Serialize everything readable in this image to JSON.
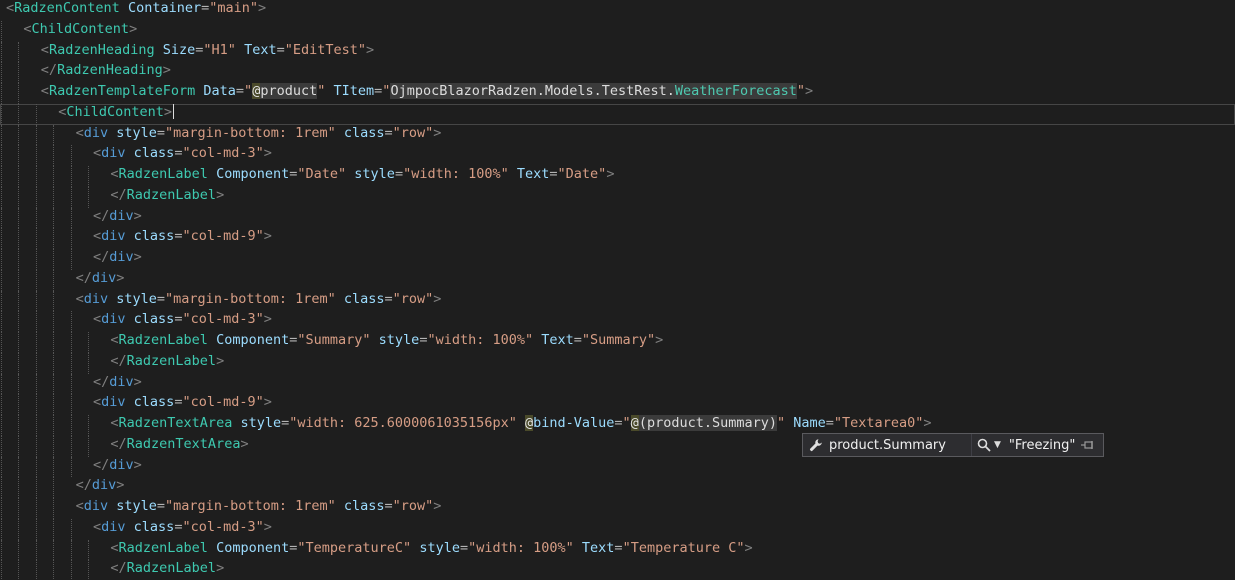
{
  "editor": {
    "lines": [
      {
        "indent": 0,
        "guides": 0,
        "tokens": [
          [
            "tk-bracket",
            "<"
          ],
          [
            "tk-comp",
            "RadzenContent"
          ],
          [
            "tk-csharp",
            " "
          ],
          [
            "tk-attr",
            "Container"
          ],
          [
            "tk-equals",
            "="
          ],
          [
            "tk-str",
            "\"main\""
          ],
          [
            "tk-bracket",
            ">"
          ]
        ]
      },
      {
        "indent": 1,
        "guides": 1,
        "tokens": [
          [
            "tk-bracket",
            "<"
          ],
          [
            "tk-comp",
            "ChildContent"
          ],
          [
            "tk-bracket",
            ">"
          ]
        ]
      },
      {
        "indent": 2,
        "guides": 2,
        "tokens": [
          [
            "tk-bracket",
            "<"
          ],
          [
            "tk-comp",
            "RadzenHeading"
          ],
          [
            "tk-csharp",
            " "
          ],
          [
            "tk-attr",
            "Size"
          ],
          [
            "tk-equals",
            "="
          ],
          [
            "tk-str",
            "\"H1\""
          ],
          [
            "tk-csharp",
            " "
          ],
          [
            "tk-attr",
            "Text"
          ],
          [
            "tk-equals",
            "="
          ],
          [
            "tk-str",
            "\"EditTest\""
          ],
          [
            "tk-bracket",
            ">"
          ]
        ]
      },
      {
        "indent": 2,
        "guides": 2,
        "tokens": [
          [
            "tk-bracket",
            "</"
          ],
          [
            "tk-comp",
            "RadzenHeading"
          ],
          [
            "tk-bracket",
            ">"
          ]
        ]
      },
      {
        "indent": 2,
        "guides": 2,
        "tokens": [
          [
            "tk-bracket",
            "<"
          ],
          [
            "tk-comp",
            "RadzenTemplateForm"
          ],
          [
            "tk-csharp",
            " "
          ],
          [
            "tk-attr",
            "Data"
          ],
          [
            "tk-equals",
            "="
          ],
          [
            "tk-str",
            "\""
          ],
          [
            "tk-at",
            "@"
          ],
          [
            "tk-hl",
            "product"
          ],
          [
            "tk-str",
            "\""
          ],
          [
            "tk-csharp",
            " "
          ],
          [
            "tk-attr",
            "TItem"
          ],
          [
            "tk-equals",
            "="
          ],
          [
            "tk-str",
            "\""
          ],
          [
            "tk-hl",
            "OjmpocBlazorRadzen.Models.TestRest."
          ],
          [
            "tk-type",
            "WeatherForecast"
          ],
          [
            "tk-str",
            "\""
          ],
          [
            "tk-bracket",
            ">"
          ]
        ]
      },
      {
        "indent": 3,
        "guides": 3,
        "current": true,
        "tokens": [
          [
            "tk-bracket",
            "<"
          ],
          [
            "tk-comp",
            "ChildContent"
          ],
          [
            "tk-bracket",
            ">"
          ]
        ]
      },
      {
        "indent": 4,
        "guides": 4,
        "tokens": [
          [
            "tk-bracket",
            "<"
          ],
          [
            "tk-tag",
            "div"
          ],
          [
            "tk-csharp",
            " "
          ],
          [
            "tk-attr",
            "style"
          ],
          [
            "tk-equals",
            "="
          ],
          [
            "tk-str",
            "\"margin-bottom: 1rem\""
          ],
          [
            "tk-csharp",
            " "
          ],
          [
            "tk-attr",
            "class"
          ],
          [
            "tk-equals",
            "="
          ],
          [
            "tk-str",
            "\"row\""
          ],
          [
            "tk-bracket",
            ">"
          ]
        ]
      },
      {
        "indent": 5,
        "guides": 5,
        "tokens": [
          [
            "tk-bracket",
            "<"
          ],
          [
            "tk-tag",
            "div"
          ],
          [
            "tk-csharp",
            " "
          ],
          [
            "tk-attr",
            "class"
          ],
          [
            "tk-equals",
            "="
          ],
          [
            "tk-str",
            "\"col-md-3\""
          ],
          [
            "tk-bracket",
            ">"
          ]
        ]
      },
      {
        "indent": 6,
        "guides": 6,
        "tokens": [
          [
            "tk-bracket",
            "<"
          ],
          [
            "tk-comp",
            "RadzenLabel"
          ],
          [
            "tk-csharp",
            " "
          ],
          [
            "tk-attr",
            "Component"
          ],
          [
            "tk-equals",
            "="
          ],
          [
            "tk-str",
            "\"Date\""
          ],
          [
            "tk-csharp",
            " "
          ],
          [
            "tk-attr",
            "style"
          ],
          [
            "tk-equals",
            "="
          ],
          [
            "tk-str",
            "\"width: 100%\""
          ],
          [
            "tk-csharp",
            " "
          ],
          [
            "tk-attr",
            "Text"
          ],
          [
            "tk-equals",
            "="
          ],
          [
            "tk-str",
            "\"Date\""
          ],
          [
            "tk-bracket",
            ">"
          ]
        ]
      },
      {
        "indent": 6,
        "guides": 6,
        "tokens": [
          [
            "tk-bracket",
            "</"
          ],
          [
            "tk-comp",
            "RadzenLabel"
          ],
          [
            "tk-bracket",
            ">"
          ]
        ]
      },
      {
        "indent": 5,
        "guides": 5,
        "tokens": [
          [
            "tk-bracket",
            "</"
          ],
          [
            "tk-tag",
            "div"
          ],
          [
            "tk-bracket",
            ">"
          ]
        ]
      },
      {
        "indent": 5,
        "guides": 5,
        "tokens": [
          [
            "tk-bracket",
            "<"
          ],
          [
            "tk-tag",
            "div"
          ],
          [
            "tk-csharp",
            " "
          ],
          [
            "tk-attr",
            "class"
          ],
          [
            "tk-equals",
            "="
          ],
          [
            "tk-str",
            "\"col-md-9\""
          ],
          [
            "tk-bracket",
            ">"
          ]
        ]
      },
      {
        "indent": 5,
        "guides": 5,
        "tokens": [
          [
            "tk-bracket",
            "</"
          ],
          [
            "tk-tag",
            "div"
          ],
          [
            "tk-bracket",
            ">"
          ]
        ]
      },
      {
        "indent": 4,
        "guides": 4,
        "tokens": [
          [
            "tk-bracket",
            "</"
          ],
          [
            "tk-tag",
            "div"
          ],
          [
            "tk-bracket",
            ">"
          ]
        ]
      },
      {
        "indent": 4,
        "guides": 4,
        "tokens": [
          [
            "tk-bracket",
            "<"
          ],
          [
            "tk-tag",
            "div"
          ],
          [
            "tk-csharp",
            " "
          ],
          [
            "tk-attr",
            "style"
          ],
          [
            "tk-equals",
            "="
          ],
          [
            "tk-str",
            "\"margin-bottom: 1rem\""
          ],
          [
            "tk-csharp",
            " "
          ],
          [
            "tk-attr",
            "class"
          ],
          [
            "tk-equals",
            "="
          ],
          [
            "tk-str",
            "\"row\""
          ],
          [
            "tk-bracket",
            ">"
          ]
        ]
      },
      {
        "indent": 5,
        "guides": 5,
        "tokens": [
          [
            "tk-bracket",
            "<"
          ],
          [
            "tk-tag",
            "div"
          ],
          [
            "tk-csharp",
            " "
          ],
          [
            "tk-attr",
            "class"
          ],
          [
            "tk-equals",
            "="
          ],
          [
            "tk-str",
            "\"col-md-3\""
          ],
          [
            "tk-bracket",
            ">"
          ]
        ]
      },
      {
        "indent": 6,
        "guides": 6,
        "tokens": [
          [
            "tk-bracket",
            "<"
          ],
          [
            "tk-comp",
            "RadzenLabel"
          ],
          [
            "tk-csharp",
            " "
          ],
          [
            "tk-attr",
            "Component"
          ],
          [
            "tk-equals",
            "="
          ],
          [
            "tk-str",
            "\"Summary\""
          ],
          [
            "tk-csharp",
            " "
          ],
          [
            "tk-attr",
            "style"
          ],
          [
            "tk-equals",
            "="
          ],
          [
            "tk-str",
            "\"width: 100%\""
          ],
          [
            "tk-csharp",
            " "
          ],
          [
            "tk-attr",
            "Text"
          ],
          [
            "tk-equals",
            "="
          ],
          [
            "tk-str",
            "\"Summary\""
          ],
          [
            "tk-bracket",
            ">"
          ]
        ]
      },
      {
        "indent": 6,
        "guides": 6,
        "tokens": [
          [
            "tk-bracket",
            "</"
          ],
          [
            "tk-comp",
            "RadzenLabel"
          ],
          [
            "tk-bracket",
            ">"
          ]
        ]
      },
      {
        "indent": 5,
        "guides": 5,
        "tokens": [
          [
            "tk-bracket",
            "</"
          ],
          [
            "tk-tag",
            "div"
          ],
          [
            "tk-bracket",
            ">"
          ]
        ]
      },
      {
        "indent": 5,
        "guides": 5,
        "tokens": [
          [
            "tk-bracket",
            "<"
          ],
          [
            "tk-tag",
            "div"
          ],
          [
            "tk-csharp",
            " "
          ],
          [
            "tk-attr",
            "class"
          ],
          [
            "tk-equals",
            "="
          ],
          [
            "tk-str",
            "\"col-md-9\""
          ],
          [
            "tk-bracket",
            ">"
          ]
        ]
      },
      {
        "indent": 6,
        "guides": 6,
        "tokens": [
          [
            "tk-bracket",
            "<"
          ],
          [
            "tk-comp",
            "RadzenTextArea"
          ],
          [
            "tk-csharp",
            " "
          ],
          [
            "tk-attr",
            "style"
          ],
          [
            "tk-equals",
            "="
          ],
          [
            "tk-str",
            "\"width: 625.6000061035156px\""
          ],
          [
            "tk-csharp",
            " "
          ],
          [
            "tk-at",
            "@"
          ],
          [
            "tk-attr",
            "bind-Value"
          ],
          [
            "tk-equals",
            "="
          ],
          [
            "tk-str",
            "\""
          ],
          [
            "tk-at",
            "@"
          ],
          [
            "tk-hl",
            "(product.Summary)"
          ],
          [
            "tk-str",
            "\""
          ],
          [
            "tk-csharp",
            " "
          ],
          [
            "tk-attr",
            "Name"
          ],
          [
            "tk-equals",
            "="
          ],
          [
            "tk-str",
            "\"Textarea0\""
          ],
          [
            "tk-bracket",
            ">"
          ]
        ]
      },
      {
        "indent": 6,
        "guides": 6,
        "tokens": [
          [
            "tk-bracket",
            "</"
          ],
          [
            "tk-comp",
            "RadzenTextArea"
          ],
          [
            "tk-bracket",
            ">"
          ]
        ]
      },
      {
        "indent": 5,
        "guides": 5,
        "tokens": [
          [
            "tk-bracket",
            "</"
          ],
          [
            "tk-tag",
            "div"
          ],
          [
            "tk-bracket",
            ">"
          ]
        ]
      },
      {
        "indent": 4,
        "guides": 4,
        "tokens": [
          [
            "tk-bracket",
            "</"
          ],
          [
            "tk-tag",
            "div"
          ],
          [
            "tk-bracket",
            ">"
          ]
        ]
      },
      {
        "indent": 4,
        "guides": 4,
        "tokens": [
          [
            "tk-bracket",
            "<"
          ],
          [
            "tk-tag",
            "div"
          ],
          [
            "tk-csharp",
            " "
          ],
          [
            "tk-attr",
            "style"
          ],
          [
            "tk-equals",
            "="
          ],
          [
            "tk-str",
            "\"margin-bottom: 1rem\""
          ],
          [
            "tk-csharp",
            " "
          ],
          [
            "tk-attr",
            "class"
          ],
          [
            "tk-equals",
            "="
          ],
          [
            "tk-str",
            "\"row\""
          ],
          [
            "tk-bracket",
            ">"
          ]
        ]
      },
      {
        "indent": 5,
        "guides": 5,
        "tokens": [
          [
            "tk-bracket",
            "<"
          ],
          [
            "tk-tag",
            "div"
          ],
          [
            "tk-csharp",
            " "
          ],
          [
            "tk-attr",
            "class"
          ],
          [
            "tk-equals",
            "="
          ],
          [
            "tk-str",
            "\"col-md-3\""
          ],
          [
            "tk-bracket",
            ">"
          ]
        ]
      },
      {
        "indent": 6,
        "guides": 6,
        "tokens": [
          [
            "tk-bracket",
            "<"
          ],
          [
            "tk-comp",
            "RadzenLabel"
          ],
          [
            "tk-csharp",
            " "
          ],
          [
            "tk-attr",
            "Component"
          ],
          [
            "tk-equals",
            "="
          ],
          [
            "tk-str",
            "\"TemperatureC\""
          ],
          [
            "tk-csharp",
            " "
          ],
          [
            "tk-attr",
            "style"
          ],
          [
            "tk-equals",
            "="
          ],
          [
            "tk-str",
            "\"width: 100%\""
          ],
          [
            "tk-csharp",
            " "
          ],
          [
            "tk-attr",
            "Text"
          ],
          [
            "tk-equals",
            "="
          ],
          [
            "tk-str",
            "\"Temperature C\""
          ],
          [
            "tk-bracket",
            ">"
          ]
        ]
      },
      {
        "indent": 6,
        "guides": 6,
        "tokens": [
          [
            "tk-bracket",
            "</"
          ],
          [
            "tk-comp",
            "RadzenLabel"
          ],
          [
            "tk-bracket",
            ">"
          ]
        ]
      }
    ]
  },
  "datatip": {
    "icon": "wrench-icon",
    "expression": "product.Summary",
    "search_icon": "magnifier-icon",
    "dropdown_icon": "chevron-down-icon",
    "value": "\"Freezing\"",
    "pin_icon": "pin-icon"
  },
  "colors": {
    "background": "#1e1e1e",
    "component": "#3ec9b0",
    "attribute": "#9cdcfe",
    "string": "#d69d85",
    "html_tag": "#569cd6",
    "bracket": "#808080"
  }
}
